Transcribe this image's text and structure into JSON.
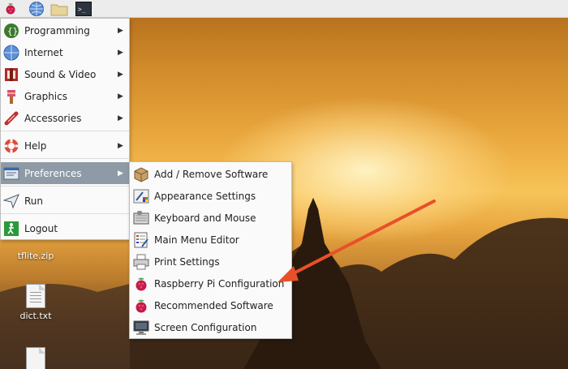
{
  "taskbar": {
    "icons": [
      "raspberry-icon",
      "globe-icon",
      "folder-icon",
      "terminal-icon"
    ]
  },
  "desktop": {
    "items": [
      {
        "label": "tflite.zip",
        "icon": "zip-file-icon"
      },
      {
        "label": "dict.txt",
        "icon": "text-file-icon"
      }
    ]
  },
  "main_menu": {
    "items": [
      {
        "label": "Programming",
        "icon": "programming-icon",
        "submenu": true
      },
      {
        "label": "Internet",
        "icon": "internet-icon",
        "submenu": true
      },
      {
        "label": "Sound & Video",
        "icon": "sound-video-icon",
        "submenu": true
      },
      {
        "label": "Graphics",
        "icon": "graphics-icon",
        "submenu": true
      },
      {
        "label": "Accessories",
        "icon": "accessories-icon",
        "submenu": true
      },
      {
        "label": "Help",
        "icon": "help-icon",
        "submenu": true
      },
      {
        "label": "Preferences",
        "icon": "preferences-icon",
        "submenu": true,
        "active": true
      },
      {
        "label": "Run",
        "icon": "run-icon",
        "submenu": false
      },
      {
        "label": "Logout",
        "icon": "logout-icon",
        "submenu": false
      }
    ]
  },
  "preferences_menu": {
    "items": [
      {
        "label": "Add / Remove Software",
        "icon": "package-icon"
      },
      {
        "label": "Appearance Settings",
        "icon": "appearance-icon"
      },
      {
        "label": "Keyboard and Mouse",
        "icon": "keyboard-icon"
      },
      {
        "label": "Main Menu Editor",
        "icon": "menu-editor-icon"
      },
      {
        "label": "Print Settings",
        "icon": "printer-icon"
      },
      {
        "label": "Raspberry Pi Configuration",
        "icon": "raspberry-icon"
      },
      {
        "label": "Recommended Software",
        "icon": "raspberry-icon"
      },
      {
        "label": "Screen Configuration",
        "icon": "monitor-icon"
      }
    ]
  },
  "annotation": {
    "type": "arrow",
    "color": "#e8502a",
    "target": "Raspberry Pi Configuration"
  },
  "colors": {
    "menu_highlight": "#8e9ba6",
    "menu_bg": "#fafafa",
    "taskbar_bg": "#edecec"
  }
}
